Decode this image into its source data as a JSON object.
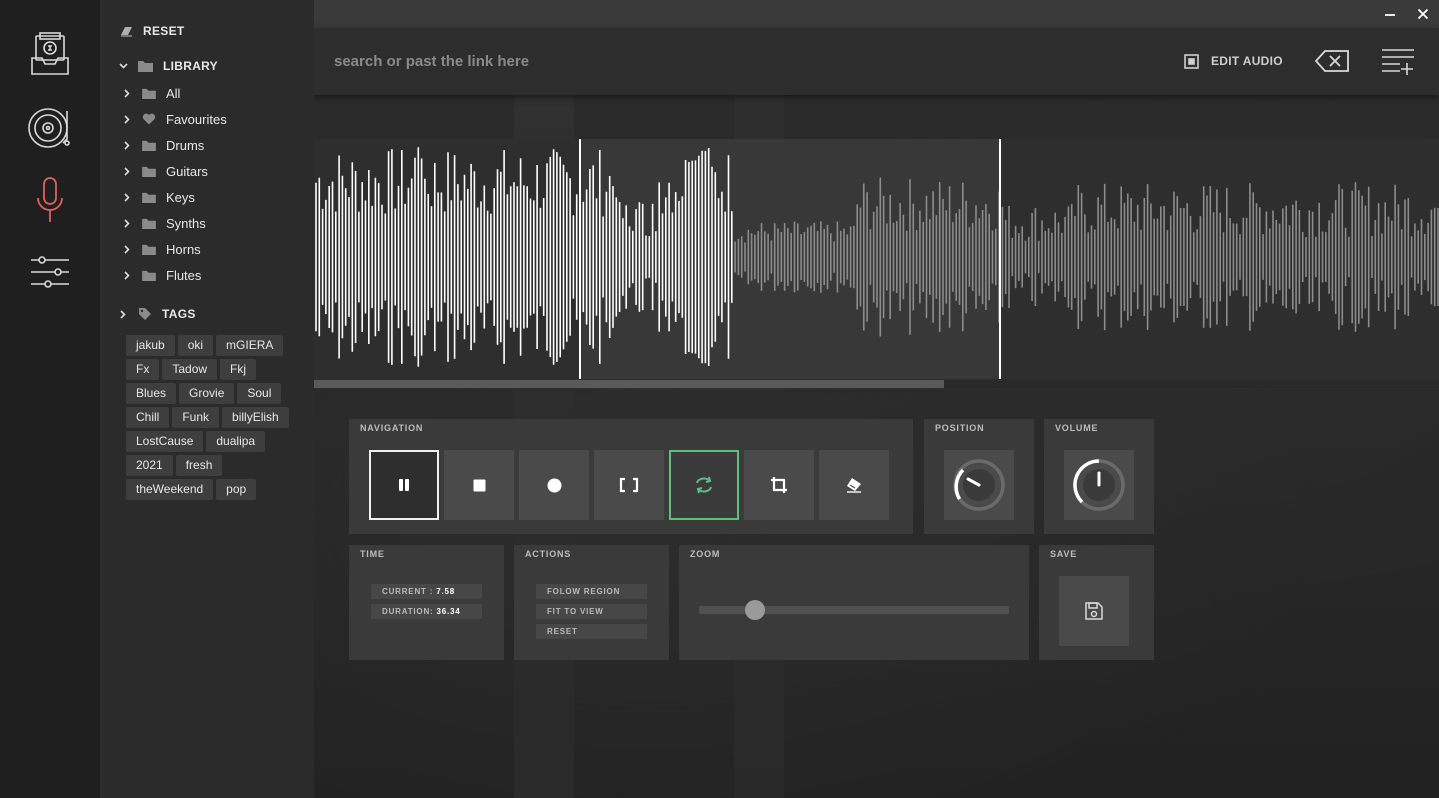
{
  "rail": {
    "items": [
      {
        "name": "music-box-icon"
      },
      {
        "name": "vinyl-turntable-icon"
      },
      {
        "name": "microphone-icon",
        "active_color": "#e0605c"
      },
      {
        "name": "sliders-icon"
      }
    ]
  },
  "sidebar": {
    "reset_label": "RESET",
    "library_label": "LIBRARY",
    "library_items": [
      {
        "label": "All",
        "icon": "folder-icon"
      },
      {
        "label": "Favourites",
        "icon": "heart-icon"
      },
      {
        "label": "Drums",
        "icon": "folder-icon"
      },
      {
        "label": "Guitars",
        "icon": "folder-icon"
      },
      {
        "label": "Keys",
        "icon": "folder-icon"
      },
      {
        "label": "Synths",
        "icon": "folder-icon"
      },
      {
        "label": "Horns",
        "icon": "folder-icon"
      },
      {
        "label": "Flutes",
        "icon": "folder-icon"
      }
    ],
    "tags_label": "TAGS",
    "tags": [
      "jakub",
      "oki",
      "mGIERA",
      "Fx",
      "Tadow",
      "Fkj",
      "Blues",
      "Grovie",
      "Soul",
      "Chill",
      "Funk",
      "billyElish",
      "LostCause",
      "dualipa",
      "2021",
      "fresh",
      "theWeekend",
      "pop"
    ]
  },
  "header": {
    "search_placeholder": "search or past the link here",
    "edit_audio_label": "EDIT AUDIO"
  },
  "waveform": {
    "scroll_fraction": 0.56
  },
  "navigation": {
    "title": "NAVIGATION",
    "buttons": [
      {
        "name": "pause-button",
        "icon": "pause-icon",
        "state": "active"
      },
      {
        "name": "stop-button",
        "icon": "stop-icon"
      },
      {
        "name": "record-button",
        "icon": "record-icon"
      },
      {
        "name": "region-button",
        "icon": "brackets-icon"
      },
      {
        "name": "loop-button",
        "icon": "loop-icon",
        "state": "loop-on"
      },
      {
        "name": "crop-button",
        "icon": "crop-icon"
      },
      {
        "name": "erase-button",
        "icon": "eraser-icon"
      }
    ]
  },
  "position": {
    "title": "POSITION"
  },
  "volume": {
    "title": "VOLUME"
  },
  "time": {
    "title": "TIME",
    "current_label": "CURRENT :",
    "current_value": "7.58",
    "duration_label": "DURATION:",
    "duration_value": "36.34"
  },
  "actions": {
    "title": "ACTIONS",
    "follow_region": "FOLOW REGION",
    "fit_to_view": "FIT TO VIEW",
    "reset": "RESET"
  },
  "zoom": {
    "title": "ZOOM",
    "level_fraction": 0.18
  },
  "save": {
    "title": "SAVE"
  },
  "colors": {
    "accent_loop": "#5fbf7a",
    "mic_red": "#e0605c"
  }
}
